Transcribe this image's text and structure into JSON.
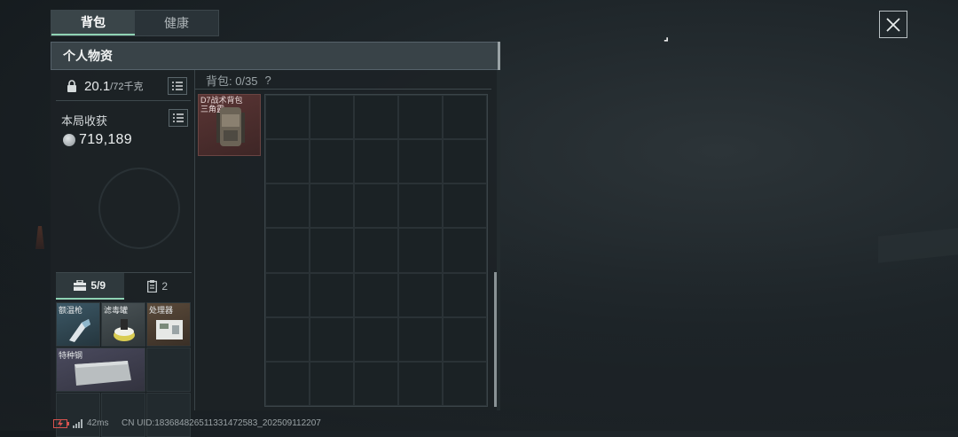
{
  "tabs": [
    {
      "label": "背包",
      "active": true
    },
    {
      "label": "健康",
      "active": false
    }
  ],
  "panel": {
    "title": "个人物资"
  },
  "weight": {
    "current": "20.1",
    "max": "/72千克"
  },
  "earnings": {
    "label": "本局收获",
    "value": "719,189"
  },
  "sub_tabs": [
    {
      "label": "5/9",
      "icon": "toolbox-icon",
      "active": true
    },
    {
      "label": "2",
      "icon": "clipboard-icon",
      "active": false
    }
  ],
  "gear_items": [
    {
      "label": "额温枪",
      "rarity": "blue",
      "icon": "thermometer-gun-icon"
    },
    {
      "label": "滤毒罐",
      "rarity": "gray",
      "icon": "filter-canister-icon"
    },
    {
      "label": "处理器",
      "rarity": "brown",
      "icon": "processor-icon"
    },
    {
      "label": "特种钢",
      "rarity": "purple",
      "icon": "steel-bar-icon"
    }
  ],
  "bag": {
    "label": "背包: 0/35",
    "help": "?"
  },
  "backpack_item": {
    "label_line1": "D7战术背包",
    "label_line2": "三角露",
    "rarity_color": "#5a3534",
    "icon": "backpack-icon"
  },
  "status": {
    "ping": "42ms",
    "uid": "CN UID:183684826511331472583_202509112207"
  }
}
